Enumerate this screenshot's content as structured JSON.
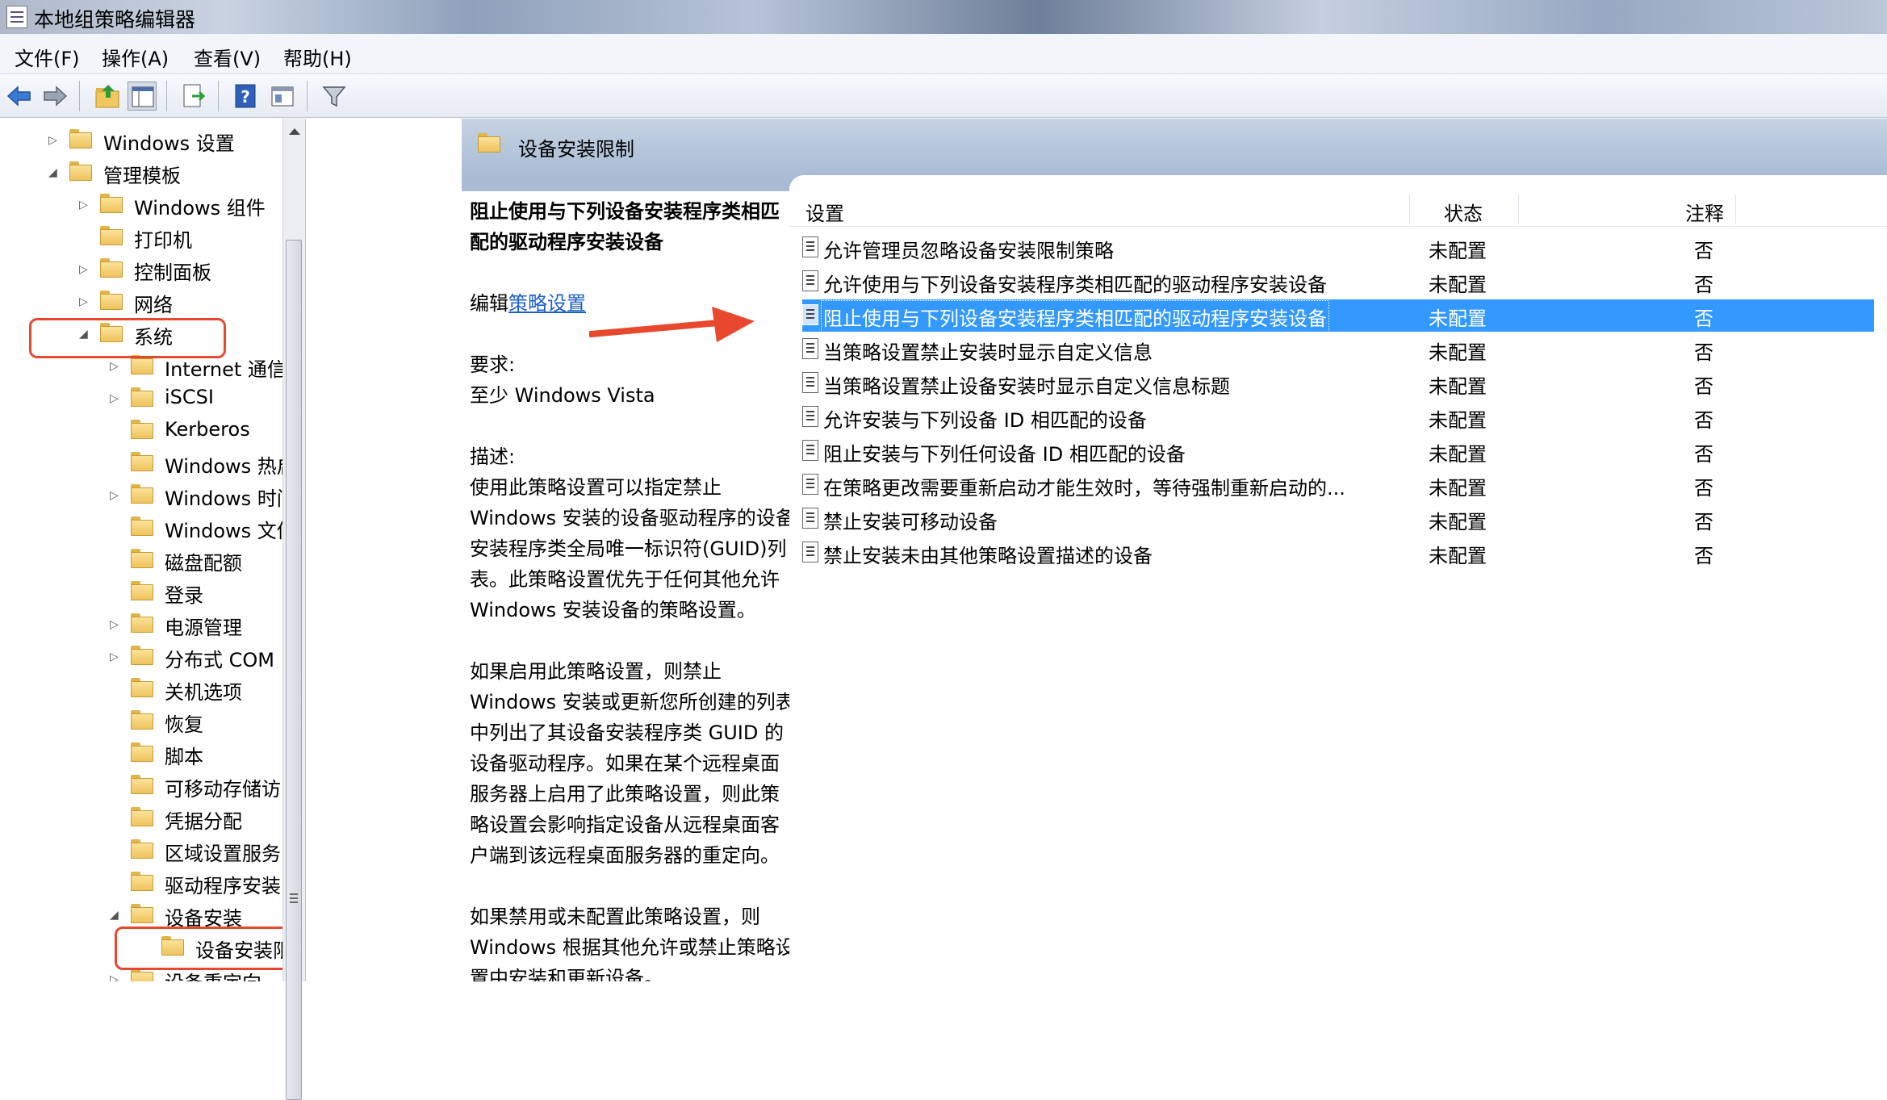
{
  "window": {
    "title": "本地组策略编辑器"
  },
  "menu": {
    "file": "文件(F)",
    "action": "操作(A)",
    "view": "查看(V)",
    "help": "帮助(H)"
  },
  "toolbar": {
    "icons": [
      "back-arrow-icon",
      "forward-arrow-icon",
      "up-folder-icon",
      "show-hide-tree-icon",
      "export-list-icon",
      "help-icon",
      "properties-icon",
      "filter-icon"
    ]
  },
  "tree": {
    "nodes": [
      {
        "label": "Windows 设置"
      },
      {
        "label": "管理模板"
      },
      {
        "label": "Windows 组件"
      },
      {
        "label": "打印机"
      },
      {
        "label": "控制面板"
      },
      {
        "label": "网络"
      },
      {
        "label": "系统"
      },
      {
        "label": "Internet 通信管理"
      },
      {
        "label": "iSCSI"
      },
      {
        "label": "Kerberos"
      },
      {
        "label": "Windows 热启动"
      },
      {
        "label": "Windows 时间服务"
      },
      {
        "label": "Windows 文件保护"
      },
      {
        "label": "磁盘配额"
      },
      {
        "label": "登录"
      },
      {
        "label": "电源管理"
      },
      {
        "label": "分布式 COM"
      },
      {
        "label": "关机选项"
      },
      {
        "label": "恢复"
      },
      {
        "label": "脚本"
      },
      {
        "label": "可移动存储访问"
      },
      {
        "label": "凭据分配"
      },
      {
        "label": "区域设置服务"
      },
      {
        "label": "驱动程序安装"
      },
      {
        "label": "设备安装"
      },
      {
        "label": "设备安装限制"
      },
      {
        "label": "设备重定向"
      }
    ]
  },
  "right": {
    "header_title": "设备安装限制",
    "desc": {
      "title_line1": "阻止使用与下列设备安装程序类相匹",
      "title_line2": "配的驱动程序安装设备",
      "edit_prefix": "编辑",
      "edit_link": "策略设置",
      "req_label": "要求:",
      "req_value": "至少 Windows Vista",
      "desc_label": "描述:",
      "p1": [
        "使用此策略设置可以指定禁止",
        "Windows 安装的设备驱动程序的设备",
        "安装程序类全局唯一标识符(GUID)列",
        "表。此策略设置优先于任何其他允许",
        "Windows 安装设备的策略设置。"
      ],
      "p2": [
        "如果启用此策略设置，则禁止",
        "Windows 安装或更新您所创建的列表",
        "中列出了其设备安装程序类 GUID 的",
        "设备驱动程序。如果在某个远程桌面",
        "服务器上启用了此策略设置，则此策",
        "略设置会影响指定设备从远程桌面客",
        "户端到该远程桌面服务器的重定向。"
      ],
      "p3": [
        "如果禁用或未配置此策略设置，则",
        "Windows 根据其他允许或禁止策略设",
        "置中安装和更新设备。"
      ]
    },
    "columns": {
      "setting": "设置",
      "status": "状态",
      "note": "注释"
    },
    "rows": [
      {
        "name": "允许管理员忽略设备安装限制策略",
        "status": "未配置",
        "note": "否"
      },
      {
        "name": "允许使用与下列设备安装程序类相匹配的驱动程序安装设备",
        "status": "未配置",
        "note": "否"
      },
      {
        "name": "阻止使用与下列设备安装程序类相匹配的驱动程序安装设备",
        "status": "未配置",
        "note": "否",
        "selected": true
      },
      {
        "name": "当策略设置禁止安装时显示自定义信息",
        "status": "未配置",
        "note": "否"
      },
      {
        "name": "当策略设置禁止设备安装时显示自定义信息标题",
        "status": "未配置",
        "note": "否"
      },
      {
        "name": "允许安装与下列设备 ID 相匹配的设备",
        "status": "未配置",
        "note": "否"
      },
      {
        "name": "阻止安装与下列任何设备 ID 相匹配的设备",
        "status": "未配置",
        "note": "否"
      },
      {
        "name": "在策略更改需要重新启动才能生效时，等待强制重新启动的...",
        "status": "未配置",
        "note": "否"
      },
      {
        "name": "禁止安装可移动设备",
        "status": "未配置",
        "note": "否"
      },
      {
        "name": "禁止安装未由其他策略设置描述的设备",
        "status": "未配置",
        "note": "否"
      }
    ]
  },
  "colors": {
    "selection": "#3399ff",
    "annotation": "#e8492e",
    "link": "#1d5fc6"
  }
}
